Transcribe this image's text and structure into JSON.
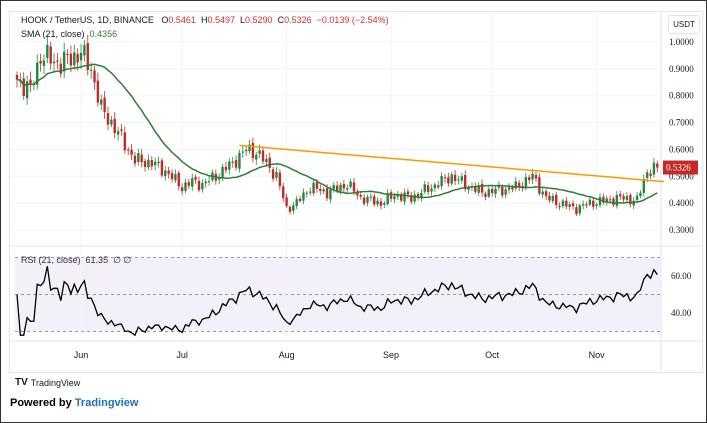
{
  "header": {
    "symbol": "HOOK / TetherUS, 1D, BINANCE",
    "o_label": "O",
    "o": "0.5461",
    "h_label": "H",
    "h": "0.5497",
    "l_label": "L",
    "l": "0.5290",
    "c_label": "C",
    "c": "0.5326",
    "change": "−0.0139 (−2.54%)"
  },
  "sma_legend": {
    "label": "SMA (21, close)",
    "value": "0.4356"
  },
  "rsi_legend": {
    "label": "RSI (21, close)",
    "value": "61.35",
    "extra": "∅ ∅"
  },
  "currency": "USDT",
  "last_price": "0.5326",
  "colors": {
    "up": "#1e8a3c",
    "down": "#c62828",
    "sma": "#2e7d32",
    "trend": "#ff9800",
    "rsi": "#000000",
    "rsi_bg": "#f3f0fa",
    "price_tag": "#c62828"
  },
  "footer": {
    "brand": "TradingView",
    "powered_by": "Powered by",
    "powered_link": "Tradingview"
  },
  "chart_data": {
    "type": "candlestick",
    "price_axis": {
      "ticks": [
        "1.0000",
        "0.9000",
        "0.8000",
        "0.7000",
        "0.6000",
        "0.5000",
        "0.4000",
        "0.3000"
      ],
      "ylim": [
        0.27,
        1.06
      ]
    },
    "rsi_axis": {
      "ticks": [
        "60.00",
        "40.00"
      ],
      "levels": [
        70,
        50,
        30
      ]
    },
    "x_ticks": [
      {
        "label": "Jun",
        "day": 19
      },
      {
        "label": "Jul",
        "day": 49
      },
      {
        "label": "Aug",
        "day": 80
      },
      {
        "label": "Sep",
        "day": 111
      },
      {
        "label": "Oct",
        "day": 141
      },
      {
        "label": "Nov",
        "day": 172
      }
    ],
    "price_path": [
      [
        0,
        0.86
      ],
      [
        4,
        0.82
      ],
      [
        7,
        0.95
      ],
      [
        13,
        0.92
      ],
      [
        19,
        0.96
      ],
      [
        22,
        0.9
      ],
      [
        25,
        0.75
      ],
      [
        28,
        0.7
      ],
      [
        32,
        0.62
      ],
      [
        35,
        0.56
      ],
      [
        40,
        0.55
      ],
      [
        44,
        0.52
      ],
      [
        49,
        0.46
      ],
      [
        52,
        0.48
      ],
      [
        55,
        0.47
      ],
      [
        59,
        0.5
      ],
      [
        64,
        0.55
      ],
      [
        68,
        0.6
      ],
      [
        71,
        0.59
      ],
      [
        74,
        0.55
      ],
      [
        77,
        0.5
      ],
      [
        80,
        0.38
      ],
      [
        83,
        0.4
      ],
      [
        87,
        0.46
      ],
      [
        92,
        0.44
      ],
      [
        98,
        0.47
      ],
      [
        102,
        0.42
      ],
      [
        108,
        0.4
      ],
      [
        112,
        0.43
      ],
      [
        117,
        0.42
      ],
      [
        123,
        0.46
      ],
      [
        129,
        0.5
      ],
      [
        133,
        0.47
      ],
      [
        138,
        0.44
      ],
      [
        144,
        0.45
      ],
      [
        148,
        0.46
      ],
      [
        153,
        0.5
      ],
      [
        157,
        0.42
      ],
      [
        161,
        0.4
      ],
      [
        166,
        0.38
      ],
      [
        170,
        0.4
      ],
      [
        175,
        0.41
      ],
      [
        179,
        0.42
      ],
      [
        184,
        0.41
      ],
      [
        187,
        0.52
      ],
      [
        190,
        0.5326
      ]
    ],
    "sma_period": 21,
    "rsi_period": 21,
    "trendline": {
      "from": [
        66,
        0.615
      ],
      "to": [
        192,
        0.48
      ]
    }
  }
}
